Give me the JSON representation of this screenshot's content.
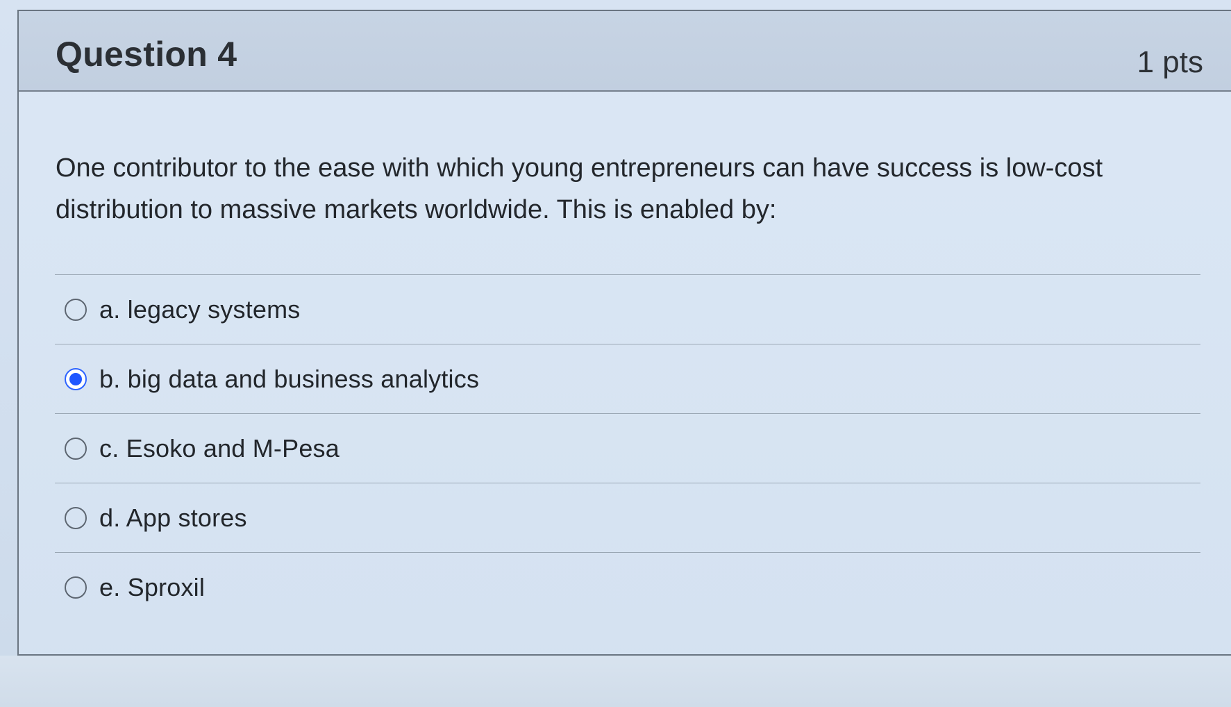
{
  "question": {
    "title": "Question 4",
    "points": "1 pts",
    "prompt": "One contributor to the ease with which young entrepreneurs can have success is low-cost distribution to massive markets worldwide. This is enabled by:",
    "answers": [
      {
        "label": "a. legacy systems",
        "selected": false
      },
      {
        "label": "b. big data and business analytics",
        "selected": true
      },
      {
        "label": "c. Esoko and M-Pesa",
        "selected": false
      },
      {
        "label": "d. App stores",
        "selected": false
      },
      {
        "label": "e. Sproxil",
        "selected": false
      }
    ]
  },
  "colors": {
    "selected_radio": "#1f56ff",
    "header_background": "#c7d4e4",
    "page_background": "#d3e0f0"
  }
}
